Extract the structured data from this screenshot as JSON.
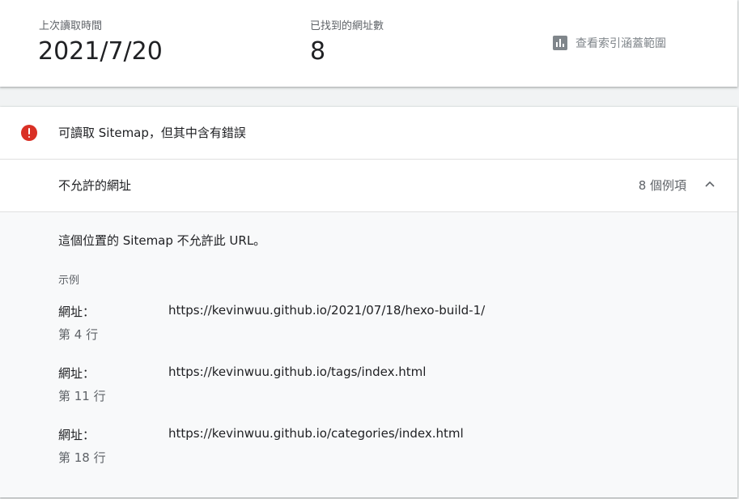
{
  "stats": {
    "last_read_label": "上次讀取時間",
    "last_read_value": "2021/7/20",
    "urls_found_label": "已找到的網址數",
    "urls_found_value": "8",
    "coverage_link_label": "查看索引涵蓋範圍",
    "coverage_icon": "bar-chart-icon"
  },
  "status": {
    "icon": "error-icon",
    "icon_color": "#d93025",
    "text": "可讀取 Sitemap，但其中含有錯誤"
  },
  "issue": {
    "title": "不允許的網址",
    "count_label": "8 個例項",
    "toggle_icon": "chevron-up-icon",
    "description": "這個位置的 Sitemap 不允許此 URL。",
    "examples_label": "示例",
    "examples": [
      {
        "key": "網址：",
        "url": "https://kevinwuu.github.io/2021/07/18/hexo-build-1/",
        "line": "第 4 行"
      },
      {
        "key": "網址：",
        "url": "https://kevinwuu.github.io/tags/index.html",
        "line": "第 11 行"
      },
      {
        "key": "網址：",
        "url": "https://kevinwuu.github.io/categories/index.html",
        "line": "第 18 行"
      }
    ]
  }
}
